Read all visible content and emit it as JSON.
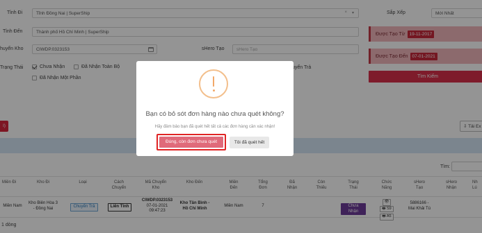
{
  "filters": {
    "tinh_di": {
      "label": "Tỉnh Đi",
      "value": "Tỉnh Đồng Nai | SuperShip"
    },
    "tinh_den": {
      "label": "Tỉnh Đến",
      "value": "Thành phố Hồ Chí Minh | SuperShip"
    },
    "chuyen_kho": {
      "label": "huyển Kho",
      "value": "CIWDP.0323153"
    },
    "shero_tao": {
      "label": "sHero Tạo",
      "placeholder": "sHero Tạo"
    },
    "trang_thai": {
      "label": "Trạng Thái"
    },
    "chua_nhan": "Chưa Nhận",
    "da_nhan_toan_bo": "Đã Nhận Toàn Bộ",
    "da_nhan_mot_phan": "Đã Nhận Một Phần",
    "uyen_tra": "uyển Trả",
    "sap_xep": {
      "label": "Sắp Xếp",
      "value": "Mới Nhất"
    },
    "duoc_tao_tu": {
      "label": "Được Tạo Từ",
      "value": "19-11-2017"
    },
    "duoc_tao_den": {
      "label": "Được Tạo Đến",
      "value": "07-01-2021"
    },
    "search_label": "Tìm Kiếm"
  },
  "toolbar": {
    "red_stub": "I)",
    "export_label": "Tải Ex",
    "tim_label": "Tìm:"
  },
  "table": {
    "headers": [
      "Miền Đi",
      "Kho Đi",
      "Loại",
      "Cách Chuyển",
      "Mã Chuyển Kho",
      "Kho Đến",
      "Miền Đến",
      "Tổng Đơn",
      "Đã Nhận",
      "Còn Thiếu",
      "Trạng Thái",
      "Chức Năng",
      "sHero Tạo",
      "sHero Nhận",
      "Nh Lú"
    ],
    "row": {
      "mien_di": "Miền Nam",
      "kho_di": "Kho Biên Hòa 3 - Đồng Nai",
      "loai": "Chuyển Trả",
      "cach_chuyen": "Liên Tỉnh",
      "ma_chuyen_kho": "CIWDP.0323153",
      "ma_date": "07-01-2021",
      "ma_time": "09:47:23",
      "kho_den": "Kho Tân Bình - Hồ Chí Minh",
      "mien_den": "Miền Nam",
      "tong_don": "7",
      "trang_thai": "Chưa Nhận",
      "btn_eye": "👁",
      "btn_print_s9": "🖶 S9",
      "btn_print_a5": "🖶 A5",
      "shero_tao": "5886166 - Mai Khải Tú"
    },
    "count": "1 dòng"
  },
  "modal": {
    "icon": "!",
    "title": "Bạn có bỏ sót đơn hàng nào chưa quét không?",
    "text": "Hãy đảm bảo bạn đã quét hết tất cả các đơn hàng cần xác nhận!",
    "confirm_label": "Đúng, còn đơn chưa quét",
    "cancel_label": "Tôi đã quét hết"
  }
}
